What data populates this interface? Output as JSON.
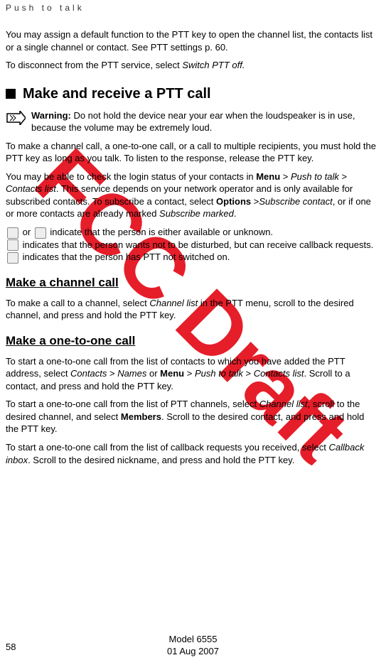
{
  "header": "Push to talk",
  "intro_p1_plain1": "You may assign a default function to the PTT key to open the channel list, the contacts list or a single channel or contact. See PTT settings p. 60.",
  "intro_p2_plain": "To disconnect from the PTT service, select ",
  "intro_p2_italic": "Switch PTT off.",
  "heading_main": "Make and receive a PTT call",
  "warning_label": "Warning:",
  "warning_text": " Do not hold the device near your ear when the loudspeaker is in use, because the volume may be extremely loud.",
  "p3": "To make a channel call, a one-to-one call, or a call to multiple recipients, you must hold the PTT key as long as you talk. To listen to the response, release the PTT key.",
  "p4a": "You may be able to check the login status of your contacts in ",
  "p4b_bold": "Menu",
  "p4c": " > ",
  "p4d_italic": "Push to talk",
  "p4e": " > ",
  "p4f_italic": "Contacts list",
  "p4g": ". This service depends on your network operator and is only available for subscribed contacts. To subscribe a contact, select ",
  "p4h_bold": "Options",
  "p4i": " >",
  "p4j_italic": "Subscribe contact",
  "p4k": ", or if one or more contacts are already marked ",
  "p4l_italic": "Subscribe marked",
  "p4m": ".",
  "p5a": " or ",
  "p5b": " indicate that the person is either available or unknown.",
  "p5c": " indicates that the person wants not to be disturbed, but can receive callback requests. ",
  "p5d": " indicates that the person has PTT not switched on.",
  "sub1": "Make a channel call",
  "p6a": "To make a call to a channel, select ",
  "p6b_italic": "Channel list",
  "p6c": " in the PTT menu, scroll to the desired channel, and press and hold the PTT key.",
  "sub2": "Make a one-to-one call",
  "p7a": "To start a one-to-one call from the list of contacts to which you have added the PTT address, select ",
  "p7b_italic": "Contacts",
  "p7c": " > ",
  "p7d_italic": "Names",
  "p7e": " or ",
  "p7f_bold": "Menu",
  "p7g": " > ",
  "p7h_italic": "Push to talk",
  "p7i": " > ",
  "p7j_italic": "Contacts list",
  "p7k": ". Scroll to a contact, and press and hold the PTT key.",
  "p8a": "To start a one-to-one call from the list of PTT channels, select ",
  "p8b_italic": "Channel list",
  "p8c": ", scroll to the desired channel, and select ",
  "p8d_bold": "Members",
  "p8e": ". Scroll to the desired contact, and press and hold the PTT key.",
  "p9a": "To start a one-to-one call from the list of callback requests you received, select ",
  "p9b_italic": "Callback inbox",
  "p9c": ". Scroll to the desired nickname, and press and hold the PTT key.",
  "watermark": "FCC Draft",
  "page_num": "58",
  "footer_model": "Model 6555",
  "footer_date": "01 Aug 2007"
}
